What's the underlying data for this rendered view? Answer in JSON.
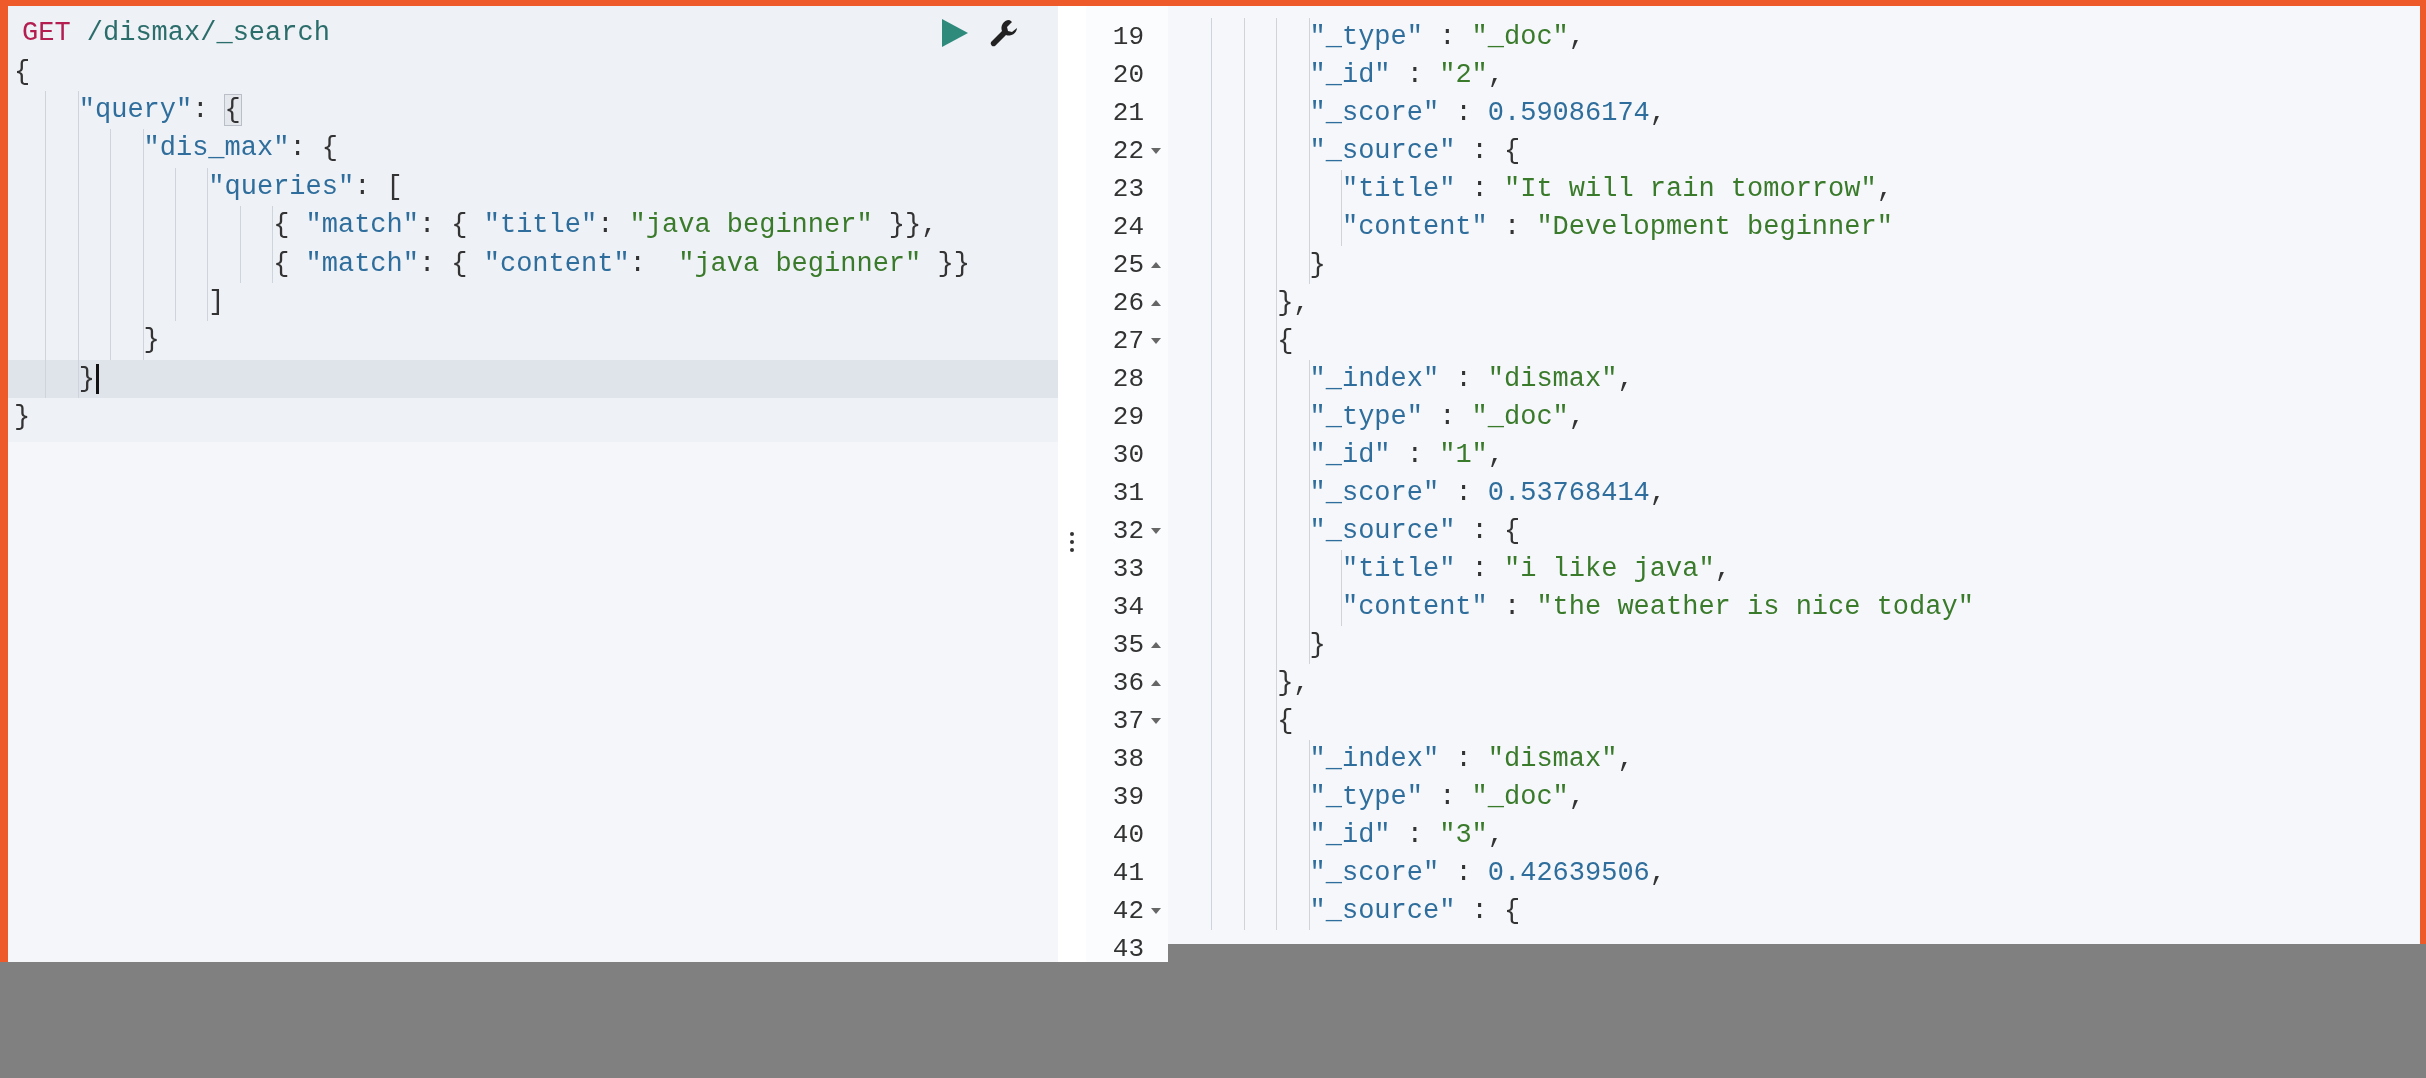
{
  "request_editor": {
    "request_line": [
      {
        "kind": "method",
        "text": "GET"
      },
      {
        "kind": "url",
        "text": " /dismax/_search"
      }
    ],
    "lines": [
      {
        "active": false,
        "tokens": [
          {
            "kind": "punct",
            "text": "{"
          }
        ]
      },
      {
        "active": false,
        "tokens": [
          {
            "kind": "key",
            "text": "\"query\""
          },
          {
            "kind": "punct",
            "text": ": "
          },
          {
            "kind": "punct",
            "text": "{",
            "matched": true
          }
        ]
      },
      {
        "active": false,
        "tokens": [
          {
            "kind": "key",
            "text": "\"dis_max\""
          },
          {
            "kind": "punct",
            "text": ": {"
          }
        ]
      },
      {
        "active": false,
        "tokens": [
          {
            "kind": "key",
            "text": "\"queries\""
          },
          {
            "kind": "punct",
            "text": ": ["
          }
        ]
      },
      {
        "active": false,
        "tokens": [
          {
            "kind": "punct",
            "text": "{ "
          },
          {
            "kind": "key",
            "text": "\"match\""
          },
          {
            "kind": "punct",
            "text": ": { "
          },
          {
            "kind": "key",
            "text": "\"title\""
          },
          {
            "kind": "punct",
            "text": ": "
          },
          {
            "kind": "string",
            "text": "\"java beginner\""
          },
          {
            "kind": "punct",
            "text": " }},"
          }
        ]
      },
      {
        "active": false,
        "tokens": [
          {
            "kind": "punct",
            "text": "{ "
          },
          {
            "kind": "key",
            "text": "\"match\""
          },
          {
            "kind": "punct",
            "text": ": { "
          },
          {
            "kind": "key",
            "text": "\"content\""
          },
          {
            "kind": "punct",
            "text": ":  "
          },
          {
            "kind": "string",
            "text": "\"java beginner\""
          },
          {
            "kind": "punct",
            "text": " }}"
          }
        ]
      },
      {
        "active": false,
        "tokens": [
          {
            "kind": "punct",
            "text": "]"
          }
        ]
      },
      {
        "active": false,
        "tokens": [
          {
            "kind": "punct",
            "text": "}"
          }
        ]
      },
      {
        "active": true,
        "tokens": [
          {
            "kind": "punct",
            "text": "}",
            "cursor": true
          }
        ]
      },
      {
        "active": false,
        "tokens": [
          {
            "kind": "punct",
            "text": "}"
          }
        ]
      }
    ]
  },
  "response_viewer": {
    "lines": [
      {
        "number": "19",
        "kind": "plain",
        "tokens": [
          {
            "kind": "key",
            "text": "\"_type\""
          },
          {
            "kind": "punct",
            "text": " : "
          },
          {
            "kind": "string",
            "text": "\"_doc\""
          },
          {
            "kind": "punct",
            "text": ","
          }
        ]
      },
      {
        "number": "20",
        "kind": "plain",
        "tokens": [
          {
            "kind": "key",
            "text": "\"_id\""
          },
          {
            "kind": "punct",
            "text": " : "
          },
          {
            "kind": "string",
            "text": "\"2\""
          },
          {
            "kind": "punct",
            "text": ","
          }
        ]
      },
      {
        "number": "21",
        "kind": "plain",
        "tokens": [
          {
            "kind": "key",
            "text": "\"_score\""
          },
          {
            "kind": "punct",
            "text": " : "
          },
          {
            "kind": "number",
            "text": "0.59086174"
          },
          {
            "kind": "punct",
            "text": ","
          }
        ]
      },
      {
        "number": "22",
        "kind": "fold_start",
        "tokens": [
          {
            "kind": "key",
            "text": "\"_source\""
          },
          {
            "kind": "punct",
            "text": " : {"
          }
        ]
      },
      {
        "number": "23",
        "kind": "plain",
        "tokens": [
          {
            "kind": "key",
            "text": "\"title\""
          },
          {
            "kind": "punct",
            "text": " : "
          },
          {
            "kind": "string",
            "text": "\"It will rain tomorrow\""
          },
          {
            "kind": "punct",
            "text": ","
          }
        ]
      },
      {
        "number": "24",
        "kind": "plain",
        "tokens": [
          {
            "kind": "key",
            "text": "\"content\""
          },
          {
            "kind": "punct",
            "text": " : "
          },
          {
            "kind": "string",
            "text": "\"Development beginner\""
          }
        ]
      },
      {
        "number": "25",
        "kind": "fold_end",
        "tokens": [
          {
            "kind": "punct",
            "text": "}"
          }
        ]
      },
      {
        "number": "26",
        "kind": "fold_end",
        "tokens": [
          {
            "kind": "punct",
            "text": "},"
          }
        ]
      },
      {
        "number": "27",
        "kind": "fold_start",
        "tokens": [
          {
            "kind": "punct",
            "text": "{"
          }
        ]
      },
      {
        "number": "28",
        "kind": "plain",
        "tokens": [
          {
            "kind": "key",
            "text": "\"_index\""
          },
          {
            "kind": "punct",
            "text": " : "
          },
          {
            "kind": "string",
            "text": "\"dismax\""
          },
          {
            "kind": "punct",
            "text": ","
          }
        ]
      },
      {
        "number": "29",
        "kind": "plain",
        "tokens": [
          {
            "kind": "key",
            "text": "\"_type\""
          },
          {
            "kind": "punct",
            "text": " : "
          },
          {
            "kind": "string",
            "text": "\"_doc\""
          },
          {
            "kind": "punct",
            "text": ","
          }
        ]
      },
      {
        "number": "30",
        "kind": "plain",
        "tokens": [
          {
            "kind": "key",
            "text": "\"_id\""
          },
          {
            "kind": "punct",
            "text": " : "
          },
          {
            "kind": "string",
            "text": "\"1\""
          },
          {
            "kind": "punct",
            "text": ","
          }
        ]
      },
      {
        "number": "31",
        "kind": "plain",
        "tokens": [
          {
            "kind": "key",
            "text": "\"_score\""
          },
          {
            "kind": "punct",
            "text": " : "
          },
          {
            "kind": "number",
            "text": "0.53768414"
          },
          {
            "kind": "punct",
            "text": ","
          }
        ]
      },
      {
        "number": "32",
        "kind": "fold_start",
        "tokens": [
          {
            "kind": "key",
            "text": "\"_source\""
          },
          {
            "kind": "punct",
            "text": " : {"
          }
        ]
      },
      {
        "number": "33",
        "kind": "plain",
        "tokens": [
          {
            "kind": "key",
            "text": "\"title\""
          },
          {
            "kind": "punct",
            "text": " : "
          },
          {
            "kind": "string",
            "text": "\"i like java\""
          },
          {
            "kind": "punct",
            "text": ","
          }
        ]
      },
      {
        "number": "34",
        "kind": "plain",
        "tokens": [
          {
            "kind": "key",
            "text": "\"content\""
          },
          {
            "kind": "punct",
            "text": " : "
          },
          {
            "kind": "string",
            "text": "\"the weather is nice today\""
          }
        ]
      },
      {
        "number": "35",
        "kind": "fold_end",
        "tokens": [
          {
            "kind": "punct",
            "text": "}"
          }
        ]
      },
      {
        "number": "36",
        "kind": "fold_end",
        "tokens": [
          {
            "kind": "punct",
            "text": "},"
          }
        ]
      },
      {
        "number": "37",
        "kind": "fold_start",
        "tokens": [
          {
            "kind": "punct",
            "text": "{"
          }
        ]
      },
      {
        "number": "38",
        "kind": "plain",
        "tokens": [
          {
            "kind": "key",
            "text": "\"_index\""
          },
          {
            "kind": "punct",
            "text": " : "
          },
          {
            "kind": "string",
            "text": "\"dismax\""
          },
          {
            "kind": "punct",
            "text": ","
          }
        ]
      },
      {
        "number": "39",
        "kind": "plain",
        "tokens": [
          {
            "kind": "key",
            "text": "\"_type\""
          },
          {
            "kind": "punct",
            "text": " : "
          },
          {
            "kind": "string",
            "text": "\"_doc\""
          },
          {
            "kind": "punct",
            "text": ","
          }
        ]
      },
      {
        "number": "40",
        "kind": "plain",
        "tokens": [
          {
            "kind": "key",
            "text": "\"_id\""
          },
          {
            "kind": "punct",
            "text": " : "
          },
          {
            "kind": "string",
            "text": "\"3\""
          },
          {
            "kind": "punct",
            "text": ","
          }
        ]
      },
      {
        "number": "41",
        "kind": "plain",
        "tokens": [
          {
            "kind": "key",
            "text": "\"_score\""
          },
          {
            "kind": "punct",
            "text": " : "
          },
          {
            "kind": "number",
            "text": "0.42639506"
          },
          {
            "kind": "punct",
            "text": ","
          }
        ]
      },
      {
        "number": "42",
        "kind": "fold_start",
        "tokens": [
          {
            "kind": "key",
            "text": "\"_source\""
          },
          {
            "kind": "punct",
            "text": " : {"
          }
        ]
      },
      {
        "number": "43",
        "kind": "plain"
      }
    ]
  }
}
